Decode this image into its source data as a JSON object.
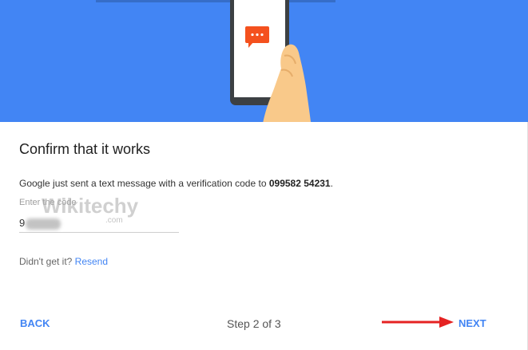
{
  "colors": {
    "hero_background": "#4285f4",
    "link": "#4285f4",
    "annotation_arrow": "#e52222",
    "chat_icon": "#f4511e",
    "hand_skin": "#f9c98a"
  },
  "hero": {
    "illustration": "phone-in-hand-icon",
    "message_icon": "chat-bubble-icon"
  },
  "title": "Confirm that it works",
  "message": {
    "prefix": "Google just sent a text message with a verification code to ",
    "phone_number": "099582 54231",
    "suffix": "."
  },
  "code_field": {
    "label": "Enter the code",
    "value_visible": "9"
  },
  "watermark": {
    "text": "Wikitechy",
    "subtext": ".com"
  },
  "resend": {
    "question": "Didn't get it? ",
    "link": "Resend"
  },
  "footer": {
    "back_label": "BACK",
    "step_text": "Step 2 of 3",
    "next_label": "NEXT"
  }
}
